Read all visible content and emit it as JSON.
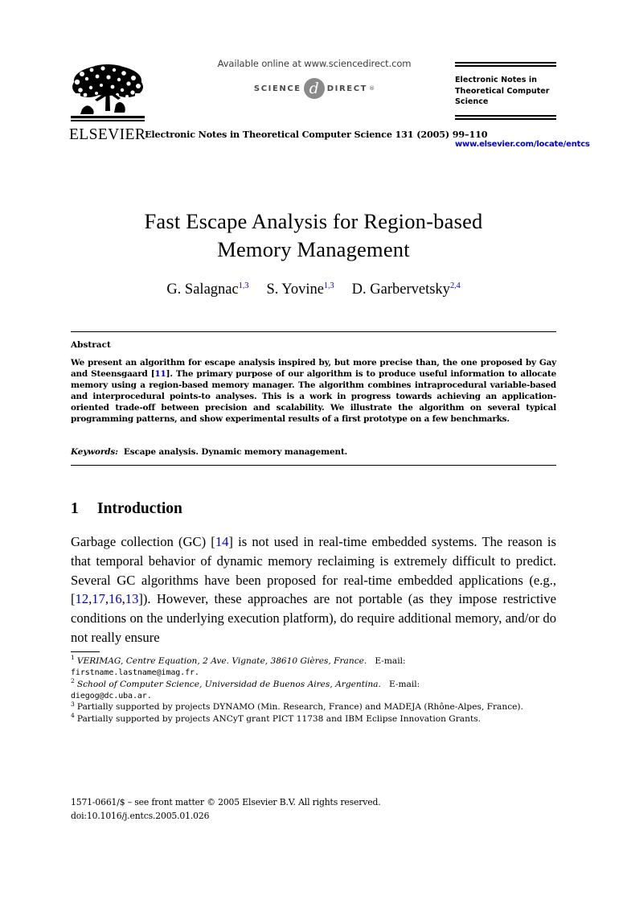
{
  "masthead": {
    "publisher_name": "ELSEVIER",
    "publisher_logo_icon": "elsevier-tree-logo",
    "sciencedirect": {
      "available_line": "Available online at www.sciencedirect.com",
      "logo_science": "SCIENCE",
      "logo_at": "d",
      "logo_direct": "DIRECT",
      "logo_registered": "®"
    },
    "journal_name": "Electronic Notes in Theoretical Computer Science",
    "citation_line": "Electronic Notes in Theoretical Computer Science 131 (2005) 99–110",
    "journal_url": "www.elsevier.com/locate/entcs",
    "link_color": "#0000cc"
  },
  "article": {
    "title_line_1": "Fast Escape Analysis for Region-based",
    "title_line_2": "Memory Management",
    "authors": [
      {
        "name": "G. Salagnac",
        "footnote_marks": [
          "1",
          "3"
        ]
      },
      {
        "name": "S. Yovine",
        "footnote_marks": [
          "1",
          "3"
        ]
      },
      {
        "name": "D. Garbervetsky",
        "footnote_marks": [
          "2",
          "4"
        ]
      }
    ]
  },
  "abstract": {
    "heading": "Abstract",
    "text_before_ref": "We present an algorithm for escape analysis inspired by, but more precise than, the one proposed by Gay and Steensgaard [",
    "ref": "11",
    "text_after_ref": "]. The primary purpose of our algorithm is to produce useful information to allocate memory using a region-based memory manager. The algorithm combines intraprocedural variable-based and interprocedural points-to analyses. This is a work in progress towards achieving an application-oriented trade-off between precision and scalability. We illustrate the algorithm on several typical programming patterns, and show experimental results of a first prototype on a few benchmarks.",
    "keywords_label": "Keywords:",
    "keywords_value": "Escape analysis. Dynamic memory management."
  },
  "section": {
    "number": "1",
    "heading": "Introduction",
    "para_part_1": "Garbage collection (GC) [",
    "para_ref_1": "14",
    "para_part_2": "] is not used in real-time embedded systems. The reason is that temporal behavior of dynamic memory reclaiming is extremely difficult to predict. Several GC algorithms have been proposed for real-time embedded applications (e.g., [",
    "para_ref_2a": "12",
    "para_ref_2b": "17",
    "para_ref_2c": "16",
    "para_ref_2d": "13",
    "para_part_3": "]). However, these approaches are not portable (as they impose restrictive conditions on the underlying execution platform), do require additional memory, and/or do not really ensure"
  },
  "footnotes": [
    {
      "mark": "1",
      "text_italic": "VERIMAG, Centre Equation, 2 Ave.   Vignate, 38610 Gières, France.",
      "text_plain": "E-mail:",
      "text_mono": "firstname.lastname@imag.fr."
    },
    {
      "mark": "2",
      "text_italic": "School of Computer Science, Universidad de Buenos Aires, Argentina.",
      "text_plain": "E-mail:",
      "text_mono": "diegog@dc.uba.ar."
    },
    {
      "mark": "3",
      "text_plain": "Partially supported by projects DYNAMO (Min.   Research, France) and MADEJA (Rhône-Alpes, France)."
    },
    {
      "mark": "4",
      "text_plain": "Partially supported by projects ANCyT grant PICT 11738 and IBM Eclipse Innovation Grants."
    }
  ],
  "publisher_footer": {
    "line_1": "1571-0661/$ – see front matter © 2005 Elsevier B.V. All rights reserved.",
    "line_2": "doi:10.1016/j.entcs.2005.01.026"
  }
}
